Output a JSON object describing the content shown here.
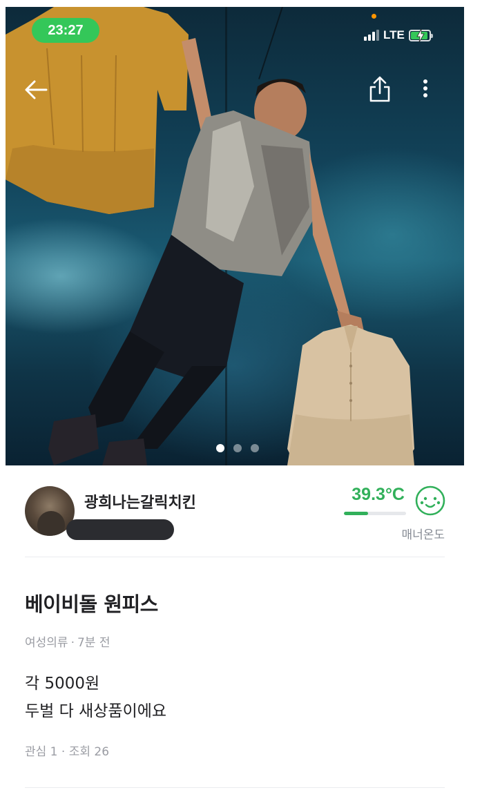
{
  "status_bar": {
    "time": "23:27",
    "network": "LTE"
  },
  "nav": {
    "back_icon": "arrow-left-icon",
    "share_icon": "share-icon",
    "more_icon": "more-vertical-icon"
  },
  "carousel": {
    "total": 3,
    "current": 1
  },
  "seller": {
    "nickname": "광희나는갈릭치킨",
    "location": "",
    "manner_temp": "39.3°C",
    "manner_level": 0.39,
    "manner_label": "매너온도"
  },
  "post": {
    "title": "베이비돌 원피스",
    "category": "여성의류",
    "time_ago": "7분 전",
    "description_lines": [
      "각 5000원",
      "두벌 다 새상품이에요"
    ],
    "interest_label": "관심 1",
    "views_label": "조회 26"
  },
  "colors": {
    "accent_green": "#31b05a",
    "status_green": "#34c759"
  }
}
